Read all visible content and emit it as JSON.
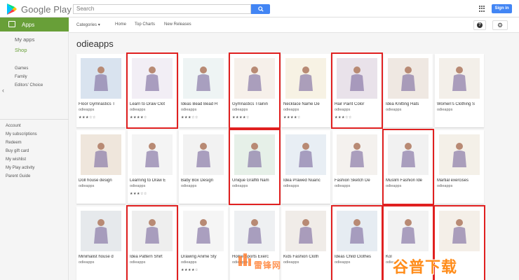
{
  "header": {
    "brand": "Google Play",
    "search_placeholder": "Search",
    "signin_label": "Sign in"
  },
  "sidebar": {
    "apps_label": "Apps",
    "my_apps": "My apps",
    "shop": "Shop",
    "sub_items": [
      "Games",
      "Family",
      "Editors' Choice"
    ],
    "account_items": [
      "Account",
      "My subscriptions",
      "Redeem",
      "Buy gift card",
      "My wishlist",
      "My Play activity",
      "Parent Guide"
    ]
  },
  "subnav": {
    "categories": "Categories",
    "home": "Home",
    "top_charts": "Top Charts",
    "new_releases": "New Releases"
  },
  "page_title": "odieapps",
  "colors": {
    "accent": "#689f38",
    "blue": "#4285f4",
    "highlight": "#e02020"
  },
  "cards": [
    {
      "title": "Floor Gymnastics T",
      "dev": "odieapps",
      "stars": "★★★☆☆",
      "icon": "gymnast-bridge-image",
      "bg": "#d9e3ef",
      "highlighted": false
    },
    {
      "title": "Learn to Draw Clot",
      "dev": "odieapps",
      "stars": "★★★★☆",
      "icon": "dress-sketch-image",
      "bg": "#f2eef5",
      "highlighted": true
    },
    {
      "title": "Ideas Bead Bead H",
      "dev": "odieapps",
      "stars": "★★★☆☆",
      "icon": "bead-necklace-image",
      "bg": "#eef4f4",
      "highlighted": false
    },
    {
      "title": "Gymnastics Trainin",
      "dev": "odieapps",
      "stars": "★★★★☆",
      "icon": "gymnasts-image",
      "bg": "#f6f0ea",
      "highlighted": true
    },
    {
      "title": "Necklace Name De",
      "dev": "odieapps",
      "stars": "★★★★☆",
      "icon": "gold-name-necklace-image",
      "bg": "#f7f2e4",
      "highlighted": false
    },
    {
      "title": "Hair Paint Color",
      "dev": "odieapps",
      "stars": "★★★☆☆",
      "icon": "pink-hair-image",
      "bg": "#e9e2ea",
      "highlighted": true
    },
    {
      "title": "Idea Knitting Hats",
      "dev": "odieapps",
      "stars": "",
      "icon": "knit-hat-image",
      "bg": "#efe8e2",
      "highlighted": false
    },
    {
      "title": "Women's Clothing S",
      "dev": "odieapps",
      "stars": "",
      "icon": "fashion-figures-image",
      "bg": "#f3efe9",
      "highlighted": false
    },
    {
      "title": "Doll house design",
      "dev": "odieapps",
      "stars": "",
      "icon": "dollhouse-image",
      "bg": "#efe6dc",
      "highlighted": false
    },
    {
      "title": "Learning to Draw E",
      "dev": "odieapps",
      "stars": "★★★☆☆",
      "icon": "eye-drawing-image",
      "bg": "#f4f4f4",
      "highlighted": false
    },
    {
      "title": "Baby Box Design",
      "dev": "odieapps",
      "stars": "",
      "icon": "crib-image",
      "bg": "#f2f2f2",
      "highlighted": false
    },
    {
      "title": "Unique Graffiti Nam",
      "dev": "odieapps",
      "stars": "",
      "icon": "graffiti-image",
      "bg": "#e6f0e8",
      "highlighted": true
    },
    {
      "title": "Idea Prawed Nuanc",
      "dev": "odieapps",
      "stars": "",
      "icon": "desert-camel-image",
      "bg": "#e8eef4",
      "highlighted": false
    },
    {
      "title": "Fashion Sketch De",
      "dev": "odieapps",
      "stars": "",
      "icon": "fashion-sketch-image",
      "bg": "#f4f1ee",
      "highlighted": false
    },
    {
      "title": "Muslim Fashion Ide",
      "dev": "odieapps",
      "stars": "",
      "icon": "hijab-fashion-image",
      "bg": "#f1f1f1",
      "highlighted": true
    },
    {
      "title": "Martial exercises",
      "dev": "odieapps",
      "stars": "",
      "icon": "martial-arts-image",
      "bg": "#f4f0e8",
      "highlighted": false
    },
    {
      "title": "Minimalist house d",
      "dev": "odieapps",
      "stars": "",
      "icon": "house-image",
      "bg": "#e6e9ec",
      "highlighted": false
    },
    {
      "title": "Idea Pattern Shirt",
      "dev": "odieapps",
      "stars": "",
      "icon": "tshirt-image",
      "bg": "#eeeeee",
      "highlighted": true
    },
    {
      "title": "Drawing Anime Sty",
      "dev": "odieapps",
      "stars": "★★★★☆",
      "icon": "anime-sketch-image",
      "bg": "#f5f5f5",
      "highlighted": false
    },
    {
      "title": "Home Sports Exerc",
      "dev": "odieapps",
      "stars": "",
      "icon": "yoga-pose-image",
      "bg": "#eef0f2",
      "highlighted": false
    },
    {
      "title": "Kids Fashion Cloth",
      "dev": "odieapps",
      "stars": "",
      "icon": "kids-fashion-image",
      "bg": "#f0ece8",
      "highlighted": false
    },
    {
      "title": "Ideas Child Clothes",
      "dev": "odieapps",
      "stars": "",
      "icon": "child-clothes-image",
      "bg": "#e6ecf2",
      "highlighted": true
    },
    {
      "title": "Kol",
      "dev": "odieapps",
      "stars": "",
      "icon": "fish-drawing-image",
      "bg": "#f2f2f2",
      "highlighted": true
    },
    {
      "title": "",
      "dev": "",
      "stars": "",
      "icon": "leather-shoes-image",
      "bg": "#f4efe8",
      "highlighted": true
    }
  ],
  "watermark": {
    "badge_text": "雷锋网",
    "big_text": "谷普下载"
  }
}
